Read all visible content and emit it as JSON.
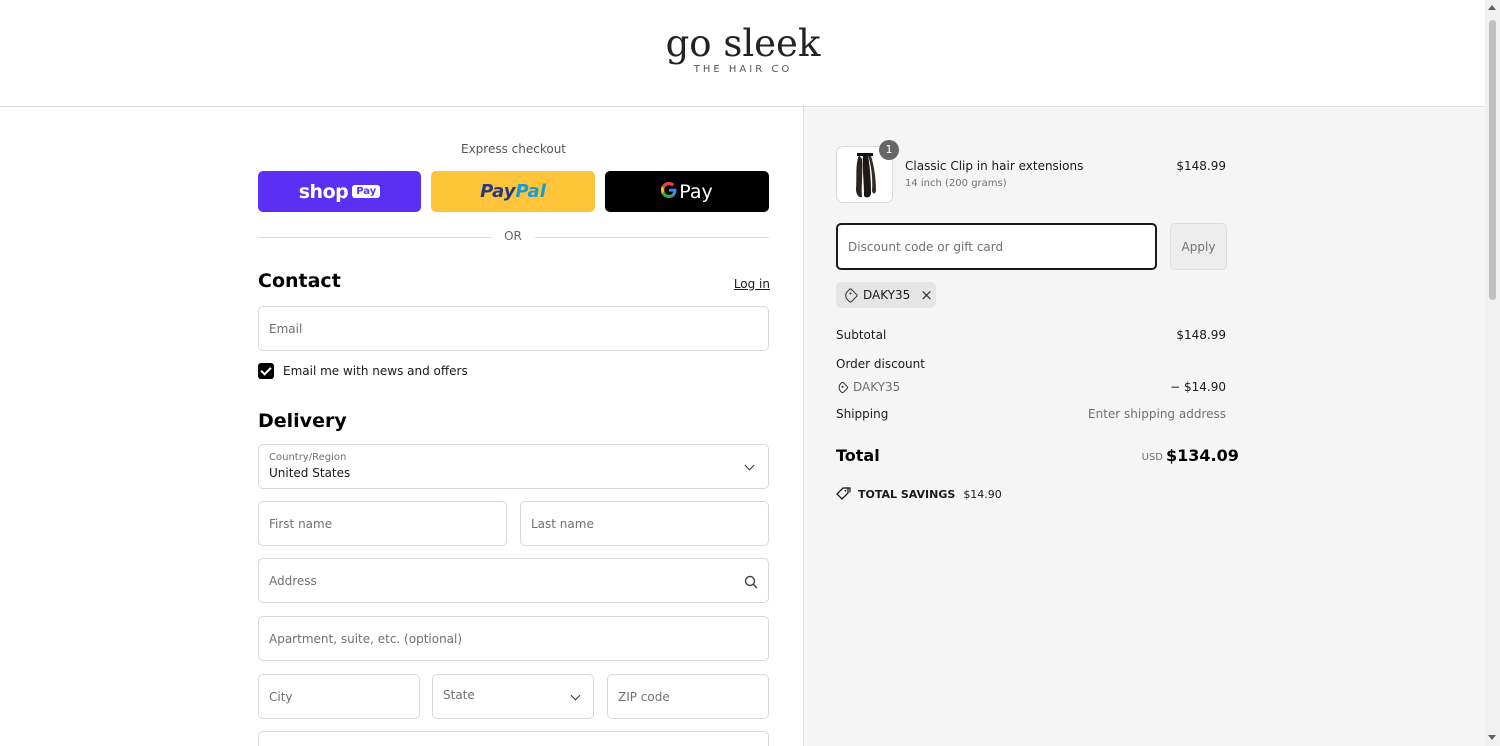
{
  "brand": {
    "name": "go sleek",
    "tagline": "THE HAIR CO"
  },
  "express": {
    "label": "Express checkout",
    "shop_pay": {
      "text": "shop",
      "badge": "Pay"
    },
    "paypal": {
      "part1": "Pay",
      "part2": "Pal"
    },
    "gpay": {
      "g": "G",
      "text": "Pay"
    },
    "or_label": "OR"
  },
  "contact": {
    "title": "Contact",
    "login_label": "Log in",
    "email_placeholder": "Email",
    "news_checkbox_label": "Email me with news and offers",
    "news_checked": true
  },
  "delivery": {
    "title": "Delivery",
    "country_label": "Country/Region",
    "country_value": "United States",
    "first_name_placeholder": "First name",
    "last_name_placeholder": "Last name",
    "address_placeholder": "Address",
    "apartment_placeholder": "Apartment, suite, etc. (optional)",
    "city_placeholder": "City",
    "state_placeholder": "State",
    "zip_placeholder": "ZIP code"
  },
  "order": {
    "item": {
      "quantity": "1",
      "name": "Classic Clip in hair extensions",
      "variant": "14 inch (200 grams)",
      "price": "$148.99"
    },
    "discount_placeholder": "Discount code or gift card",
    "apply_label": "Apply",
    "applied_code": "DAKY35",
    "subtotal_label": "Subtotal",
    "subtotal_value": "$148.99",
    "order_discount_label": "Order discount",
    "discount_code": "DAKY35",
    "discount_value": "− $14.90",
    "shipping_label": "Shipping",
    "shipping_value": "Enter shipping address",
    "total_label": "Total",
    "currency": "USD",
    "total_value": "$134.09",
    "savings_label": "TOTAL SAVINGS",
    "savings_value": "$14.90"
  },
  "colors": {
    "shop_pay": "#5a31f4",
    "paypal": "#ffc439",
    "gpay": "#000000",
    "summary_bg": "#f5f5f5"
  }
}
